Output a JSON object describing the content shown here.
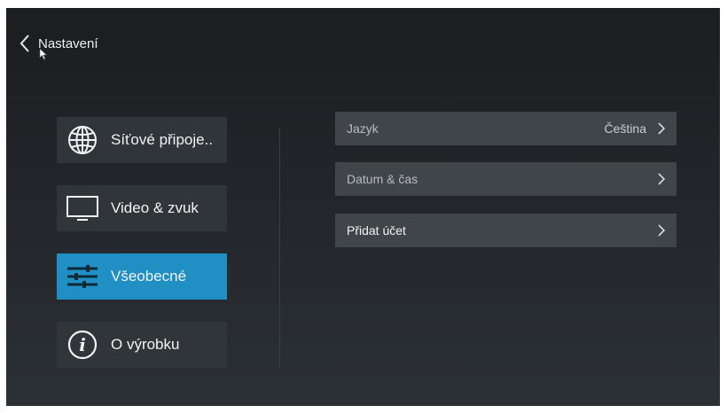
{
  "header": {
    "title": "Nastavení",
    "back_icon": "chevron-left-icon"
  },
  "menu": [
    {
      "label": "Síťové připoje..",
      "icon": "globe-icon",
      "active": false
    },
    {
      "label": "Video & zvuk",
      "icon": "monitor-icon",
      "active": false
    },
    {
      "label": "Všeobecné",
      "icon": "sliders-icon",
      "active": true
    },
    {
      "label": "O výrobku",
      "icon": "info-icon",
      "active": false
    }
  ],
  "settings": [
    {
      "label": "Jazyk",
      "value": "Čeština"
    },
    {
      "label": "Datum & čas",
      "value": ""
    },
    {
      "label": "Přidat účet",
      "value": ""
    }
  ],
  "colors": {
    "accent": "#1f8fc4",
    "tile": "#30353a",
    "row": "#40454a"
  }
}
